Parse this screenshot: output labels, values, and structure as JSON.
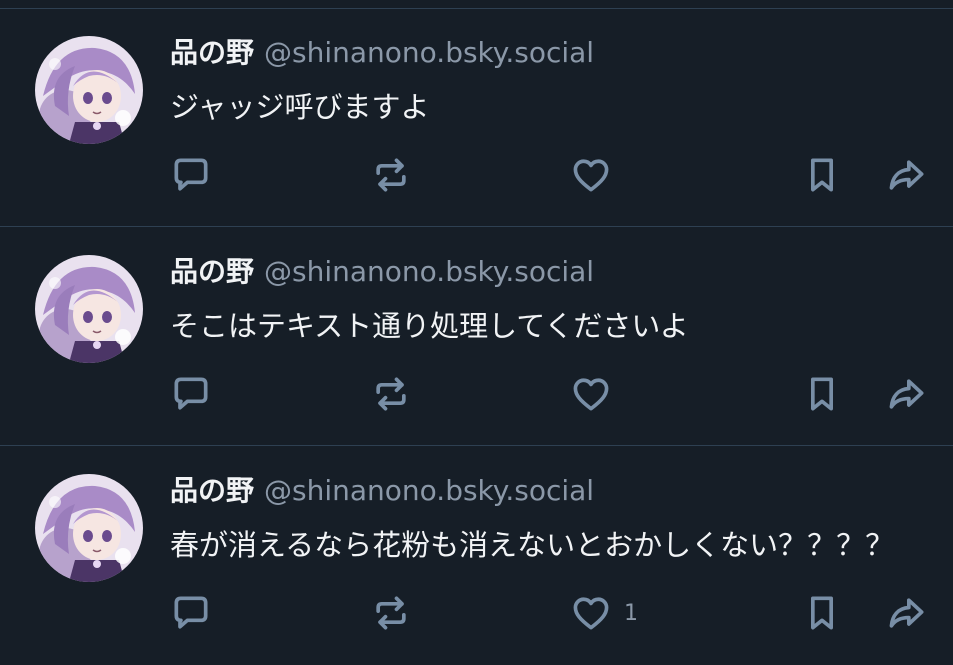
{
  "colors": {
    "background": "#161e27",
    "divider": "#2e4052",
    "text_primary": "#f1f3f5",
    "text_secondary": "#8b98a8",
    "icon": "#788ea6"
  },
  "posts": [
    {
      "display_name": "品の野",
      "handle": "@shinanono.bsky.social",
      "avatar_icon": "avatar-image",
      "text": "ジャッジ呼びますよ",
      "like_count": ""
    },
    {
      "display_name": "品の野",
      "handle": "@shinanono.bsky.social",
      "avatar_icon": "avatar-image",
      "text": "そこはテキスト通り処理してくださいよ",
      "like_count": ""
    },
    {
      "display_name": "品の野",
      "handle": "@shinanono.bsky.social",
      "avatar_icon": "avatar-image",
      "text": "春が消えるなら花粉も消えないとおかしくない？？？？",
      "like_count": "1"
    }
  ],
  "actions": {
    "reply_icon": "reply-icon",
    "repost_icon": "repost-icon",
    "like_icon": "heart-icon",
    "bookmark_icon": "bookmark-icon",
    "share_icon": "share-icon"
  }
}
